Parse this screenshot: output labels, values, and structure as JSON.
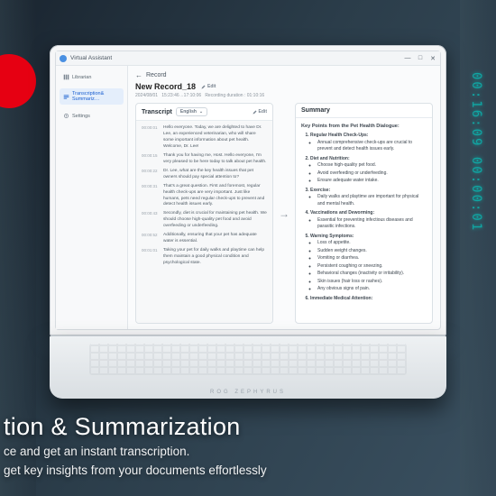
{
  "overlay": {
    "headline": "tion & Summarization",
    "sub1": "ce and get an instant transcription.",
    "sub2": " get key insights from your documents effortlessly"
  },
  "decor_digits": "00:16:09  00:00:01",
  "laptop_brand": "ROG ZEPHYRUS",
  "app": {
    "title": "Virtual Assistant",
    "win": {
      "min": "—",
      "max": "□",
      "close": "✕"
    },
    "sidebar": {
      "items": [
        {
          "icon": "library-icon",
          "label": "Librarian"
        },
        {
          "icon": "transcribe-icon",
          "label": "Transcription& Summariz…"
        },
        {
          "icon": "settings-icon",
          "label": "Settings"
        }
      ],
      "active_index": 1
    },
    "record": {
      "back_label": "Record",
      "title": "New Record_18",
      "edit_label": "Edit",
      "meta_date": "2024/08/01",
      "meta_time": "15:23:46→17:10:06",
      "meta_duration_label": "Recording duration :",
      "meta_duration": "01:10:16"
    },
    "transcript": {
      "heading": "Transcript",
      "language": "English",
      "edit_label": "Edit",
      "lines": [
        {
          "t": "00:00:01",
          "text": "Hello everyone. Today, we are delighted to have Dr. Lee, an experienced veterinarian, who will share some important information about pet health. Welcome, Dr. Lee!"
        },
        {
          "t": "00:00:15",
          "text": "Thank you for having me, Host. Hello everyone, I'm very pleased to be here today to talk about pet health."
        },
        {
          "t": "00:00:22",
          "text": "Dr. Lee, what are the key health issues that pet owners should pay special attention to?"
        },
        {
          "t": "00:00:31",
          "text": "That's a great question. First and foremost, regular health check-ups are very important. Just like humans, pets need regular check-ups to prevent and detect health issues early."
        },
        {
          "t": "00:00:43",
          "text": "Secondly, diet is crucial for maintaining pet health. We should choose high-quality pet food and avoid overfeeding or underfeeding."
        },
        {
          "t": "00:00:52",
          "text": "Additionally, ensuring that your pet has adequate water is essential."
        },
        {
          "t": "00:01:01",
          "text": "Taking your pet for daily walks and playtime can help them maintain a good physical condition and psychological state."
        }
      ]
    },
    "summary": {
      "heading": "Summary",
      "key_points_title": "Key Points from the Pet Health Dialogue:",
      "points": [
        {
          "title": "Regular Health Check-Ups:",
          "subs": [
            "Annual comprehensive check-ups are crucial to prevent and detect health issues early."
          ]
        },
        {
          "title": "Diet and Nutrition:",
          "subs": [
            "Choose high-quality pet food.",
            "Avoid overfeeding or underfeeding.",
            "Ensure adequate water intake."
          ]
        },
        {
          "title": "Exercise:",
          "subs": [
            "Daily walks and playtime are important for physical and mental health."
          ]
        },
        {
          "title": "Vaccinations and Deworming:",
          "subs": [
            "Essential for preventing infectious diseases and parasitic infections."
          ]
        },
        {
          "title": "Warning Symptoms:",
          "subs": [
            "Loss of appetite.",
            "Sudden weight changes.",
            "Vomiting or diarrhea.",
            "Persistent coughing or sneezing.",
            "Behavioral changes (inactivity or irritability).",
            "Skin issues (hair loss or rashes).",
            "Any obvious signs of pain."
          ]
        },
        {
          "title": "Immediate Medical Attention:",
          "subs": []
        }
      ]
    }
  }
}
